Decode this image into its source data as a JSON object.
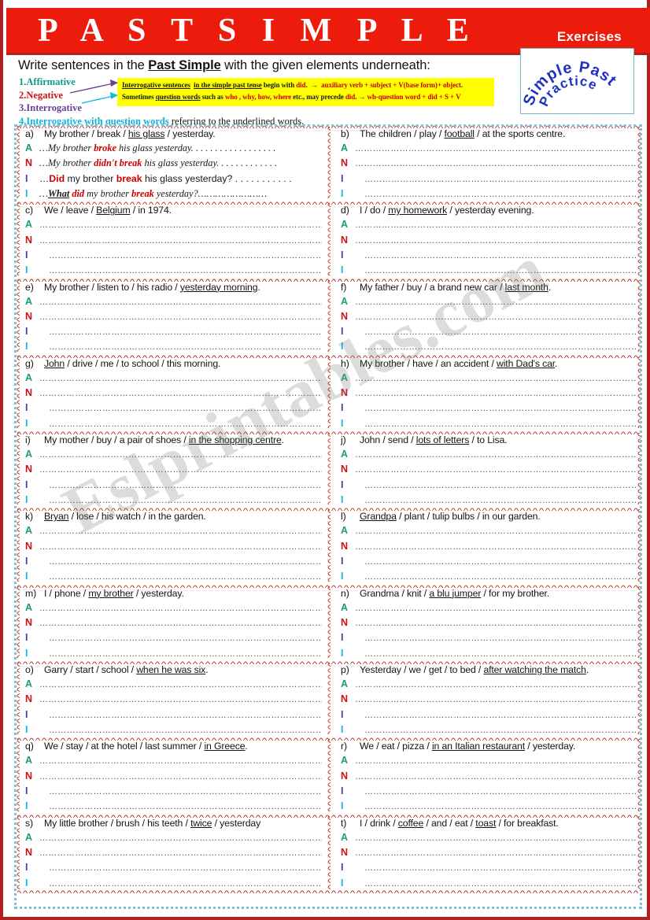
{
  "header": {
    "title": "P A S T   S I M P L E",
    "exercises_label": "Exercises",
    "logo": {
      "line1": "Simple Past",
      "line2": "Practice"
    },
    "colors": {
      "banner": "#ec1b0c",
      "banner_rule": "#b02020",
      "page_border": "#b02020"
    }
  },
  "instructions": {
    "main_pre": "Write sentences in the ",
    "main_underlined": "Past Simple",
    "main_post": " with the given elements underneath:",
    "legend": [
      {
        "num": "1.",
        "label": "Affirmative",
        "color": "#119988",
        "tail": ""
      },
      {
        "num": "2.",
        "label": "Negative",
        "color": "#cc1111",
        "tail": ""
      },
      {
        "num": "3.",
        "label": "Interrogative",
        "color": "#6a3d9a",
        "tail": ""
      },
      {
        "num": "4.",
        "label": "Interrogative with question words",
        "color": "#11b2d8",
        "tail": " referring to the underlined words."
      }
    ],
    "callout": {
      "bg": "#ffff00",
      "line1": "Interrogative sentences  in the simple past tense begin with did.  → auxiliary verb + subject + V(base form)+ object.",
      "line2": "Sometimes question words such as who , why, how, where etc., may precede did. → wh-question word + did + S + V"
    }
  },
  "answer_tags": {
    "affirmative": "A",
    "negative": "N",
    "interrogative": "I",
    "interrogative_wh": "I",
    "colors": {
      "affirmative": "#1a9e6e",
      "negative": "#cc1111",
      "interrogative": "#5a3a86",
      "interrogative_wh": "#17b7de"
    }
  },
  "dots_line": "…………………………………………………………………………………………",
  "watermark": "Eslprintables.com",
  "exercises": [
    {
      "label": "a)",
      "prompt_html": "My brother / break / <u>his glass</u> / yesterday.",
      "answers": {
        "affirmative": "…<i>My brother <b class='rd'>broke</b> his glass yesterday.</i> . . . . . . . . . . . . . . . . .",
        "negative": "…<i>My brother <b class='rd'>didn't break</b> his glass yesterday.</i> . . . . . . . . . . . .",
        "interrogative": "…<b class='rd'>Did</b> my brother <b class='rd'>break</b> his glass yesterday? . . . . . . . . . . .",
        "interrogative_wh": "…<i><u class='wh'>What</u> <b class='rd'>did</b> my brother <b class='rd'>break</b> yesterday?</i>……………………"
      }
    },
    {
      "label": "b)",
      "prompt_html": "The children / play / <u>football</u> / at the sports centre.",
      "answers": null
    },
    {
      "label": "c)",
      "prompt_html": "We / leave / <u>Belgium</u> / in 1974.",
      "answers": null
    },
    {
      "label": "d)",
      "prompt_html": "I / do / <u>my homework</u> / yesterday evening.",
      "answers": null
    },
    {
      "label": "e)",
      "prompt_html": "My brother / listen to / his radio / <u>yesterday morning</u>.",
      "answers": null
    },
    {
      "label": "f)",
      "prompt_html": "My father / buy / a brand new car / <u>last month</u>.",
      "answers": null
    },
    {
      "label": "g)",
      "prompt_html": "<u>John</u> / drive / me / to school / this morning.",
      "answers": null
    },
    {
      "label": "h)",
      "prompt_html": "My brother / have / an accident / <u>with Dad's car</u>.",
      "answers": null
    },
    {
      "label": "i)",
      "prompt_html": "My mother / buy / a pair of shoes / <u>in the shopping centre</u>.",
      "answers": null
    },
    {
      "label": "j)",
      "prompt_html": "John / send / <u>lots of letters</u> / to Lisa.",
      "answers": null
    },
    {
      "label": "k)",
      "prompt_html": "<u>Bryan</u> / lose / his watch / in the garden.",
      "answers": null
    },
    {
      "label": "l)",
      "prompt_html": "<u>Grandpa</u> / plant / tulip bulbs / in our garden.",
      "answers": null
    },
    {
      "label": "m)",
      "prompt_html": "I / phone / <u>my brother</u> / yesterday.",
      "answers": null
    },
    {
      "label": "n)",
      "prompt_html": "Grandma / knit / <u>a blu jumper</u> / for my brother.",
      "answers": null
    },
    {
      "label": "o)",
      "prompt_html": "Garry / start / school / <u>when he was six</u>.",
      "answers": null
    },
    {
      "label": "p)",
      "prompt_html": "Yesterday / we / get / to bed / <u>after watching the match</u>.",
      "answers": null
    },
    {
      "label": "q)",
      "prompt_html": "We / stay / at the hotel / last summer / <u>in Greece</u>.",
      "answers": null
    },
    {
      "label": "r)",
      "prompt_html": "We / eat / pizza / <u>in an Italian restaurant</u> / yesterday.",
      "answers": null
    },
    {
      "label": "s)",
      "prompt_html": "My little brother / brush / his teeth / <u>twice</u> / yesterday",
      "answers": null
    },
    {
      "label": "t)",
      "prompt_html": "I / drink / <u>coffee</u> / and / eat / <u>toast</u> / for breakfast.",
      "answers": null
    }
  ]
}
